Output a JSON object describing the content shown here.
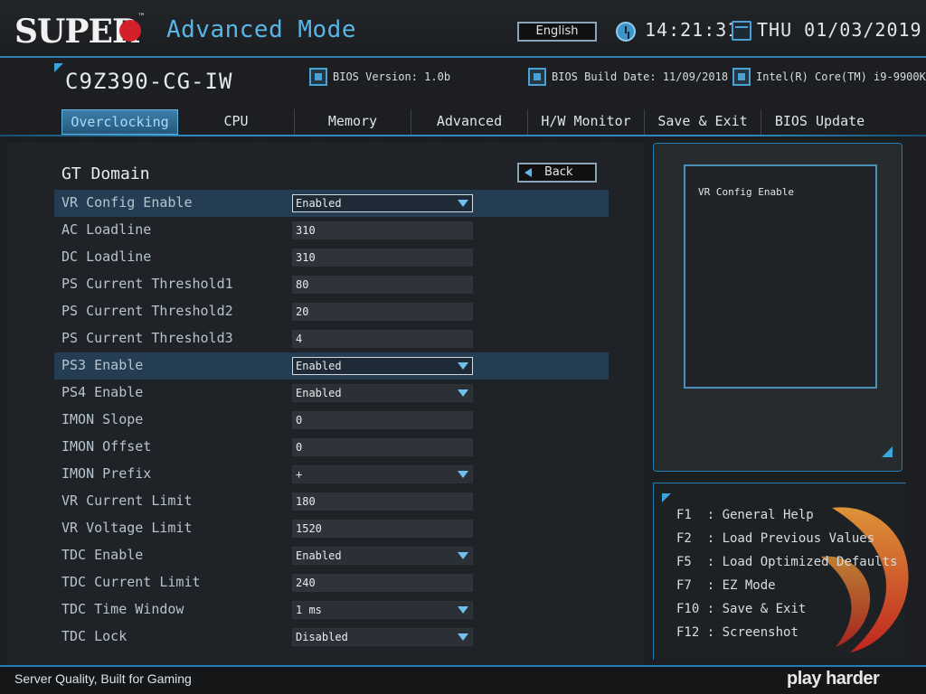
{
  "header": {
    "logo": "SUPER",
    "mode_title": "Advanced Mode",
    "language_button": "English",
    "time": "14:21:31",
    "date": "THU 01/03/2019"
  },
  "info": {
    "model": "C9Z390-CG-IW",
    "bios_version": "BIOS Version: 1.0b",
    "bios_build_date": "BIOS Build Date: 11/09/2018",
    "cpu": "Intel(R) Core(TM) i9-9900K"
  },
  "tabs": [
    {
      "label": "Overclocking",
      "active": true
    },
    {
      "label": "CPU"
    },
    {
      "label": "Memory"
    },
    {
      "label": "Advanced"
    },
    {
      "label": "H/W Monitor"
    },
    {
      "label": "Save & Exit"
    },
    {
      "label": "BIOS Update"
    }
  ],
  "section": {
    "title": "GT Domain",
    "back_button": "Back"
  },
  "settings": [
    {
      "label": "VR Config Enable",
      "value": "Enabled",
      "type": "dropdown"
    },
    {
      "label": "AC Loadline",
      "value": "310",
      "type": "input"
    },
    {
      "label": "DC Loadline",
      "value": "310",
      "type": "input"
    },
    {
      "label": "PS Current Threshold1",
      "value": "80",
      "type": "input"
    },
    {
      "label": "PS Current Threshold2",
      "value": "20",
      "type": "input"
    },
    {
      "label": "PS Current Threshold3",
      "value": "4",
      "type": "input"
    },
    {
      "label": "PS3 Enable",
      "value": "Enabled",
      "type": "dropdown"
    },
    {
      "label": "PS4 Enable",
      "value": "Enabled",
      "type": "dropdown"
    },
    {
      "label": "IMON Slope",
      "value": "0",
      "type": "input"
    },
    {
      "label": "IMON Offset",
      "value": "0",
      "type": "input"
    },
    {
      "label": "IMON Prefix",
      "value": "+",
      "type": "dropdown"
    },
    {
      "label": "VR Current Limit",
      "value": "180",
      "type": "input"
    },
    {
      "label": "VR Voltage Limit",
      "value": "1520",
      "type": "input"
    },
    {
      "label": "TDC Enable",
      "value": "Enabled",
      "type": "dropdown"
    },
    {
      "label": "TDC Current Limit",
      "value": "240",
      "type": "input"
    },
    {
      "label": "TDC Time Window",
      "value": "1 ms",
      "type": "dropdown"
    },
    {
      "label": "TDC Lock",
      "value": "Disabled",
      "type": "dropdown"
    }
  ],
  "help": {
    "text": "VR Config Enable"
  },
  "keys": [
    {
      "key": "F1",
      "action": "General Help"
    },
    {
      "key": "F2",
      "action": "Load Previous Values"
    },
    {
      "key": "F5",
      "action": "Load Optimized Defaults"
    },
    {
      "key": "F7",
      "action": "EZ Mode"
    },
    {
      "key": "F10",
      "action": "Save & Exit"
    },
    {
      "key": "F12",
      "action": "Screenshot"
    }
  ],
  "footer": {
    "tagline": "Server Quality, Built for Gaming",
    "brand": "play harder"
  },
  "colors": {
    "accent": "#3aa4dc",
    "logo_red": "#d4202a",
    "highlight_row": "#243d52"
  }
}
